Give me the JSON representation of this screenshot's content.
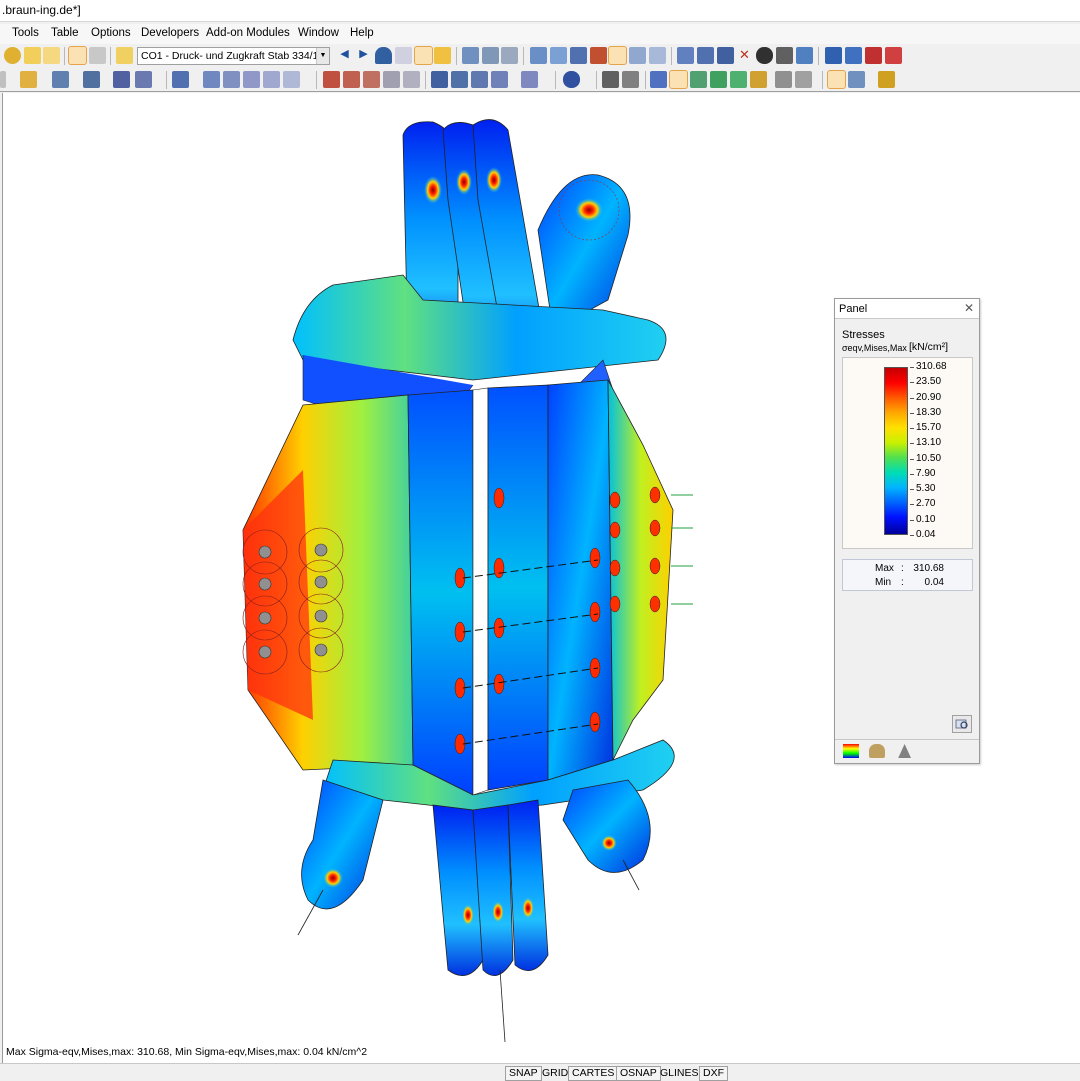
{
  "window": {
    "title": ".braun-ing.de*]"
  },
  "menu": [
    "Tools",
    "Table",
    "Options",
    "Developers",
    "Add-on Modules",
    "Window",
    "Help"
  ],
  "toolbar": {
    "loadcase_select": "CO1 - Druck- und Zugkraft Stab 334/1"
  },
  "panel": {
    "title": "Panel",
    "close": "✕",
    "section": "Stresses",
    "quantity": "σeqv,Mises,Max",
    "unit": "[kN/cm²]",
    "scale_values": [
      "310.68",
      "23.50",
      "20.90",
      "18.30",
      "15.70",
      "13.10",
      "10.50",
      "7.90",
      "5.30",
      "2.70",
      "0.10",
      "0.04"
    ],
    "max_label": "Max",
    "min_label": "Min",
    "colon": ":",
    "max_value": "310.68",
    "min_value": "0.04"
  },
  "status": {
    "message": "Max Sigma-eqv,Mises,max: 310.68, Min Sigma-eqv,Mises,max: 0.04 kN/cm^2",
    "buttons": [
      "SNAP",
      "GRID",
      "CARTES",
      "OSNAP",
      "GLINES",
      "DXF"
    ]
  },
  "colors": {
    "stress_high": "#e00000",
    "stress_mid": "#ffe000",
    "stress_low": "#0030ff",
    "accent_active": "#fbe2b4"
  }
}
